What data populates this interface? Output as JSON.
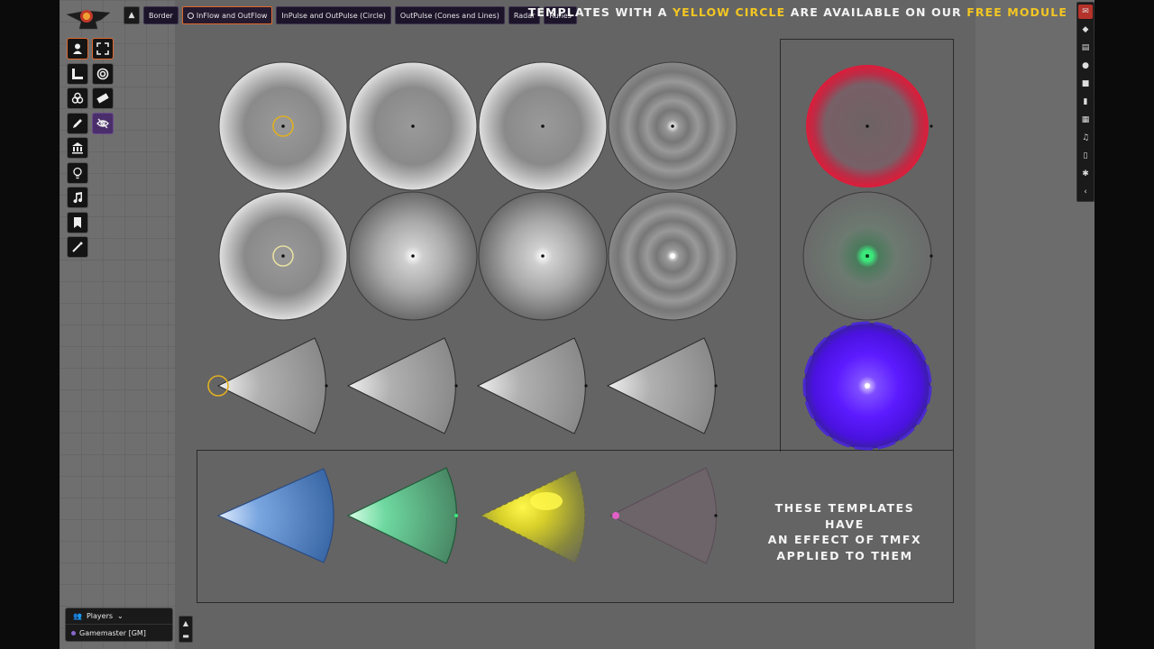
{
  "scene_nav": {
    "collapse_icon": "chevron-up",
    "tabs": [
      {
        "label": "Border",
        "active": false
      },
      {
        "label": "InFlow and OutFlow",
        "active": true
      },
      {
        "label": "InPulse and OutPulse (Circle)",
        "active": false
      },
      {
        "label": "OutPulse (Cones and Lines)",
        "active": false
      },
      {
        "label": "Radar",
        "active": false
      },
      {
        "label": "Runes",
        "active": false
      }
    ]
  },
  "banner": {
    "part1": "TEMPLATES WITH A ",
    "part2": "YELLOW CIRCLE",
    "part3": " ARE AVAILABLE ON OUR ",
    "part4": "FREE MODULE",
    "highlight_color": "#f3c623"
  },
  "note": {
    "line1": "THESE TEMPLATES HAVE",
    "line2": "AN EFFECT OF TMFX",
    "line3": "APPLIED TO THEM"
  },
  "controls": [
    {
      "icon": "token-user-icon",
      "active": true
    },
    {
      "icon": "expand-icon",
      "active": true
    },
    {
      "icon": "ruler-icon"
    },
    {
      "icon": "target-icon"
    },
    {
      "icon": "tiles-icon"
    },
    {
      "icon": "measure-tape-icon"
    },
    {
      "icon": "pencil-icon"
    },
    {
      "icon": "eye-slash-icon",
      "purple": true
    },
    {
      "icon": "bank-icon"
    },
    {
      "icon": "lightbulb-icon"
    },
    {
      "icon": "music-icon"
    },
    {
      "icon": "bookmark-icon"
    },
    {
      "icon": "magic-wand-icon"
    }
  ],
  "sidebar": {
    "items": [
      "chat-icon",
      "dice-icon",
      "map-icon",
      "users-icon",
      "suitcase-icon",
      "book-icon",
      "table-icon",
      "music-icon",
      "journal-icon",
      "cogs-icon",
      "collapse-icon"
    ]
  },
  "players": {
    "title": "Players",
    "users": [
      {
        "name": "Gamemaster [GM]",
        "color": "#8866cc"
      }
    ]
  },
  "colors": {
    "red": "#e01b3a",
    "green": "#3ce87b",
    "purple": "#5c1bff",
    "blue": "#5a8fd4",
    "teal": "#5fd89a",
    "yellow": "#e6dc30",
    "pink": "#c45ab0"
  }
}
